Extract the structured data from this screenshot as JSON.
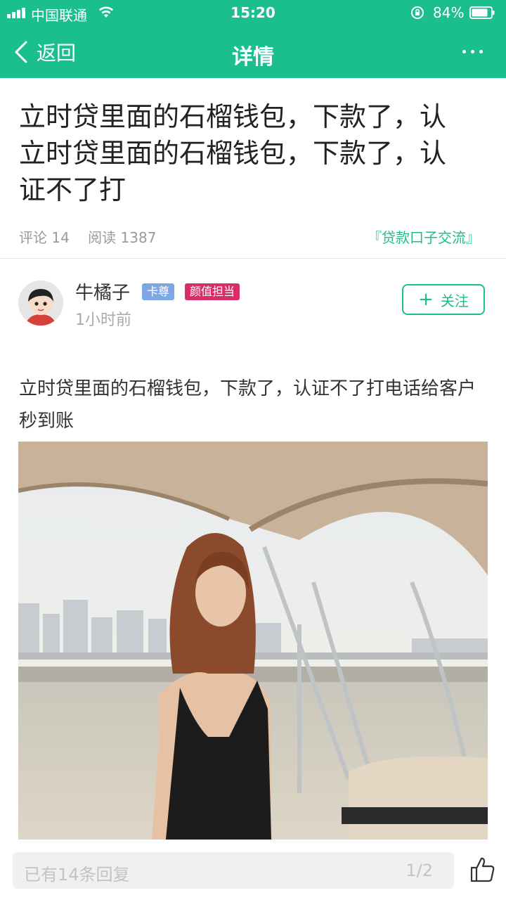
{
  "theme": {
    "accent": "#1bbf8e",
    "badge_blue": "#7fa7e6",
    "badge_pink": "#d92c6a"
  },
  "status_bar": {
    "carrier": "中国联通",
    "time": "15:20",
    "battery": "84%"
  },
  "nav": {
    "back_label": "返回",
    "title": "详情",
    "more_icon": "more-dots-icon"
  },
  "post": {
    "title": "立时贷里面的石榴钱包，下款了，认立时贷里面的石榴钱包，下款了，认证不了打",
    "comments_label": "评论 14",
    "reads_label": "阅读 1387",
    "topic": "『贷款口子交流』",
    "body": "立时贷里面的石榴钱包，下款了，认证不了打电话给客户秒到账"
  },
  "author": {
    "name": "牛橘子",
    "badges": [
      "卡尊",
      "颜值担当"
    ],
    "time": "1小时前",
    "follow_label": "关注"
  },
  "bottom_bar": {
    "reply_placeholder": "已有14条回复",
    "page_indicator": "1/2",
    "like_icon": "thumbs-up-icon"
  }
}
